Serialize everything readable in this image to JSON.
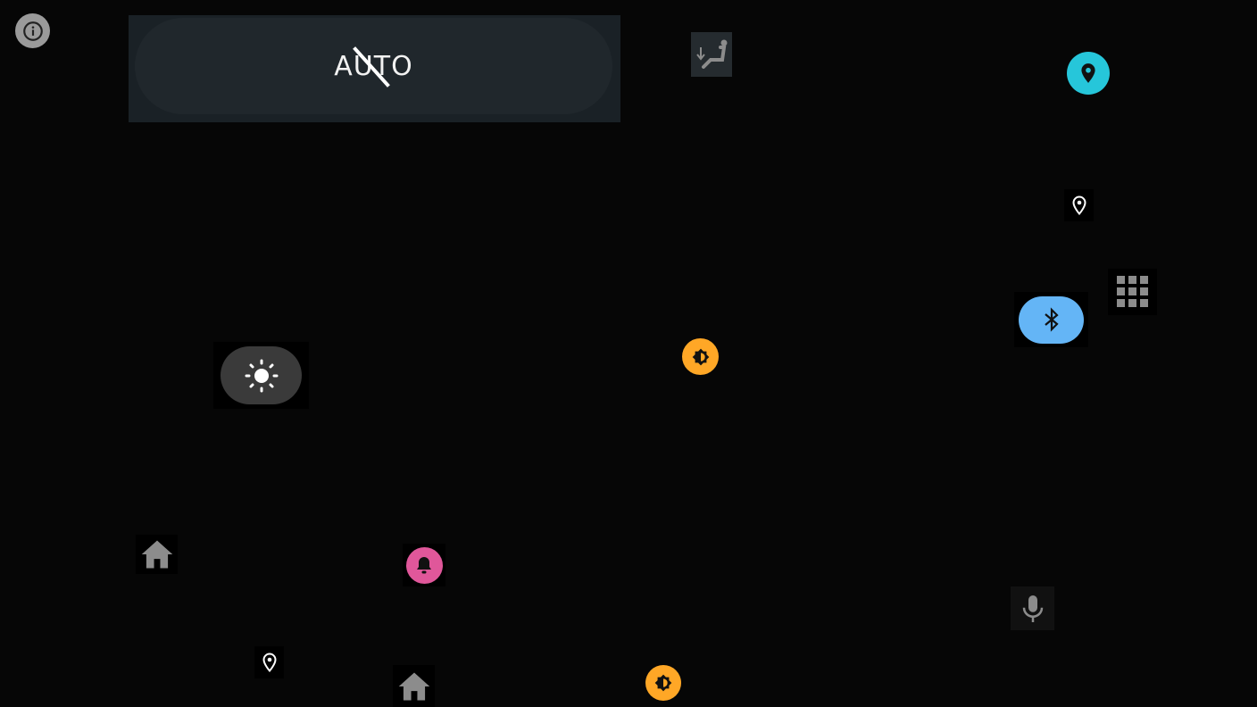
{
  "climate": {
    "auto_label": "AUTO"
  },
  "colors": {
    "background": "#060606",
    "location_active": "#26c6da",
    "bluetooth_active": "#64b5f6",
    "brightness": "#ffa726",
    "notification": "#e0579a",
    "icon_gray": "#8a8a8a"
  }
}
